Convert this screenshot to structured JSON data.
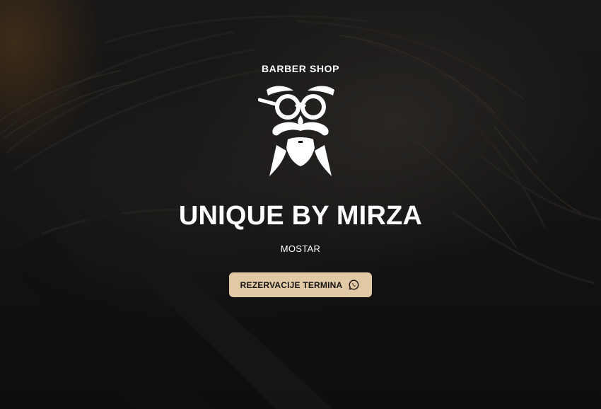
{
  "hero": {
    "eyebrow": "BARBER SHOP",
    "logo_icon": "mustache-glasses-beard-icon",
    "title": "UNIQUE BY MIRZA",
    "city": "MOSTAR",
    "cta_label": "REZERVACIJE TERMINA",
    "cta_icon": "whatsapp-icon"
  },
  "colors": {
    "background": "#151413",
    "text": "#ffffff",
    "button_bg": "#e2c9a5",
    "button_text": "#161413"
  }
}
